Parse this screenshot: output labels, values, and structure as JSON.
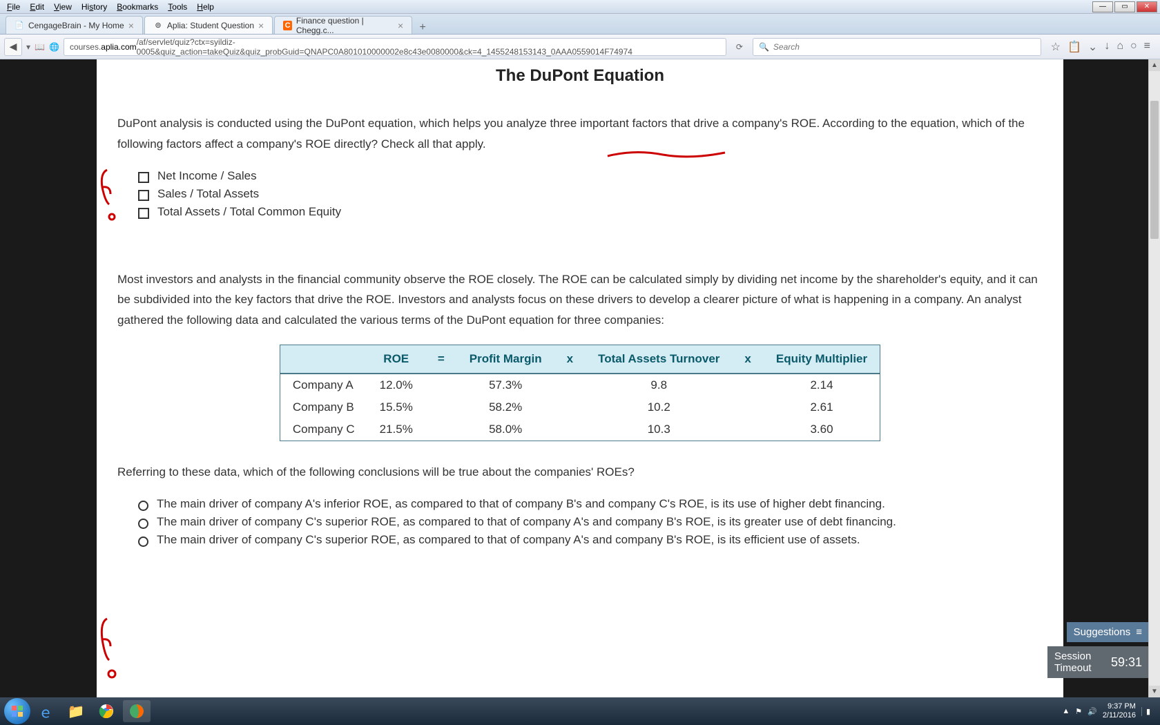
{
  "menu": [
    "File",
    "Edit",
    "View",
    "History",
    "Bookmarks",
    "Tools",
    "Help"
  ],
  "tabs": [
    {
      "label": "CengageBrain - My Home",
      "icon": "📄",
      "active": false
    },
    {
      "label": "Aplia: Student Question",
      "icon": "⊚",
      "active": true
    },
    {
      "label": "Finance question | Chegg.c...",
      "icon": "C",
      "active": false
    }
  ],
  "url": {
    "prefix": "courses.",
    "domain": "aplia.com",
    "path": "/af/servlet/quiz?ctx=syildiz-0005&quiz_action=takeQuiz&quiz_probGuid=QNAPC0A801010000002e8c43e0080000&ck=4_1455248153143_0AAA0559014F74974"
  },
  "search_placeholder": "Search",
  "page": {
    "title": "The DuPont Equation",
    "intro": "DuPont analysis is conducted using the DuPont equation, which helps you analyze three important factors that drive a company's ROE. According to the equation, which of the following factors affect a company's ROE directly? Check all that apply.",
    "checks": [
      "Net Income / Sales",
      "Sales / Total Assets",
      "Total Assets / Total Common Equity"
    ],
    "para2": "Most investors and analysts in the financial community observe the ROE closely. The ROE can be calculated simply by dividing net income by the shareholder's equity, and it can be subdivided into the key factors that drive the ROE. Investors and analysts focus on these drivers to develop a clearer picture of what is happening in a company. An analyst gathered the following data and calculated the various terms of the DuPont equation for three companies:",
    "question2": "Referring to these data, which of the following conclusions will be true about the companies' ROEs?",
    "radios": [
      "The main driver of company A's inferior ROE, as compared to that of company B's and company C's ROE, is its use of higher debt financing.",
      "The main driver of company C's superior ROE, as compared to that of company A's and company B's ROE, is its greater use of debt financing.",
      "The main driver of company C's superior ROE, as compared to that of company A's and company B's ROE, is its efficient use of assets."
    ]
  },
  "chart_data": {
    "type": "table",
    "title": "DuPont components",
    "headers": [
      "",
      "ROE",
      "=",
      "Profit Margin",
      "x",
      "Total Assets Turnover",
      "x",
      "Equity Multiplier"
    ],
    "rows": [
      {
        "name": "Company A",
        "roe": "12.0%",
        "pm": "57.3%",
        "tat": "9.8",
        "em": "2.14"
      },
      {
        "name": "Company B",
        "roe": "15.5%",
        "pm": "58.2%",
        "tat": "10.2",
        "em": "2.61"
      },
      {
        "name": "Company C",
        "roe": "21.5%",
        "pm": "58.0%",
        "tat": "10.3",
        "em": "3.60"
      }
    ]
  },
  "suggestions_label": "Suggestions",
  "session": {
    "label": "Session Timeout",
    "value": "59:31"
  },
  "tray": {
    "time": "9:37 PM",
    "date": "2/11/2016"
  }
}
